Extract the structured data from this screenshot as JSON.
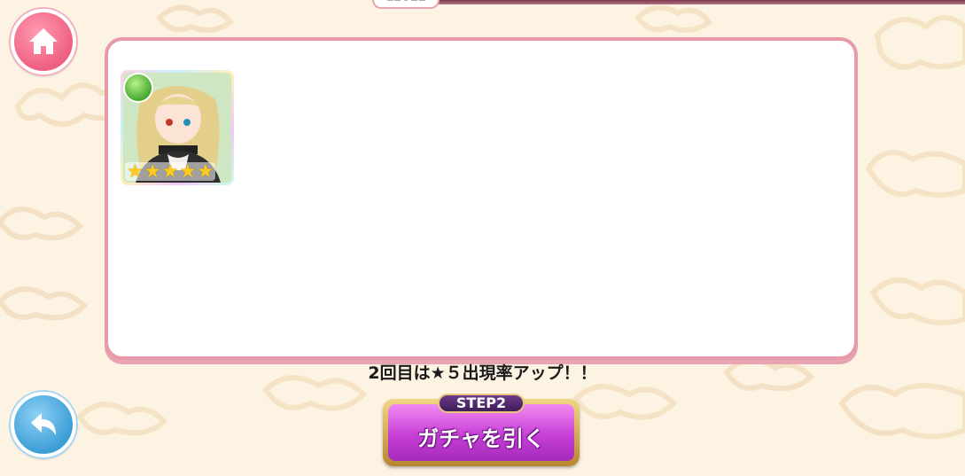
{
  "header": {
    "level_label": "LEVEL"
  },
  "nav": {
    "home_icon": "home-icon",
    "back_icon": "back-arrow-icon"
  },
  "result_card": {
    "attribute_icon": "leaf-attribute-icon",
    "rarity_stars": 5,
    "stars_display": "★★★★★"
  },
  "notice": {
    "text": "2回目は★５出現率アップ！！"
  },
  "gacha_button": {
    "step_label": "STEP2",
    "label": "ガチャを引く"
  },
  "colors": {
    "background": "#fdf3e3",
    "panel_border": "#e89aaa",
    "home_button": "#ef5f82",
    "back_button": "#3c9ed6",
    "gacha_button": "#c73fd6"
  }
}
